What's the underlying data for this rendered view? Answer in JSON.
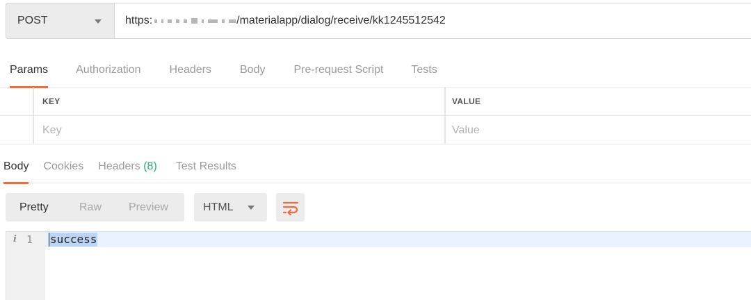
{
  "request": {
    "method": "POST",
    "url_prefix": "https:",
    "url_suffix": "/materialapp/dialog/receive/kk1245512542"
  },
  "request_tabs": [
    "Params",
    "Authorization",
    "Headers",
    "Body",
    "Pre-request Script",
    "Tests"
  ],
  "request_tab_active": "Params",
  "params": {
    "key_header": "KEY",
    "value_header": "VALUE",
    "key_placeholder": "Key",
    "value_placeholder": "Value"
  },
  "response_tabs": {
    "body": "Body",
    "cookies": "Cookies",
    "headers": "Headers",
    "headers_count": "(8)",
    "test_results": "Test Results"
  },
  "response_view": {
    "modes": [
      "Pretty",
      "Raw",
      "Preview"
    ],
    "active_mode": "Pretty",
    "format": "HTML"
  },
  "editor": {
    "line_number": "1",
    "info_glyph": "i",
    "content": "success"
  },
  "colors": {
    "accent": "#f26b3a",
    "count": "#2aa876",
    "selection": "#bcd5f5"
  }
}
